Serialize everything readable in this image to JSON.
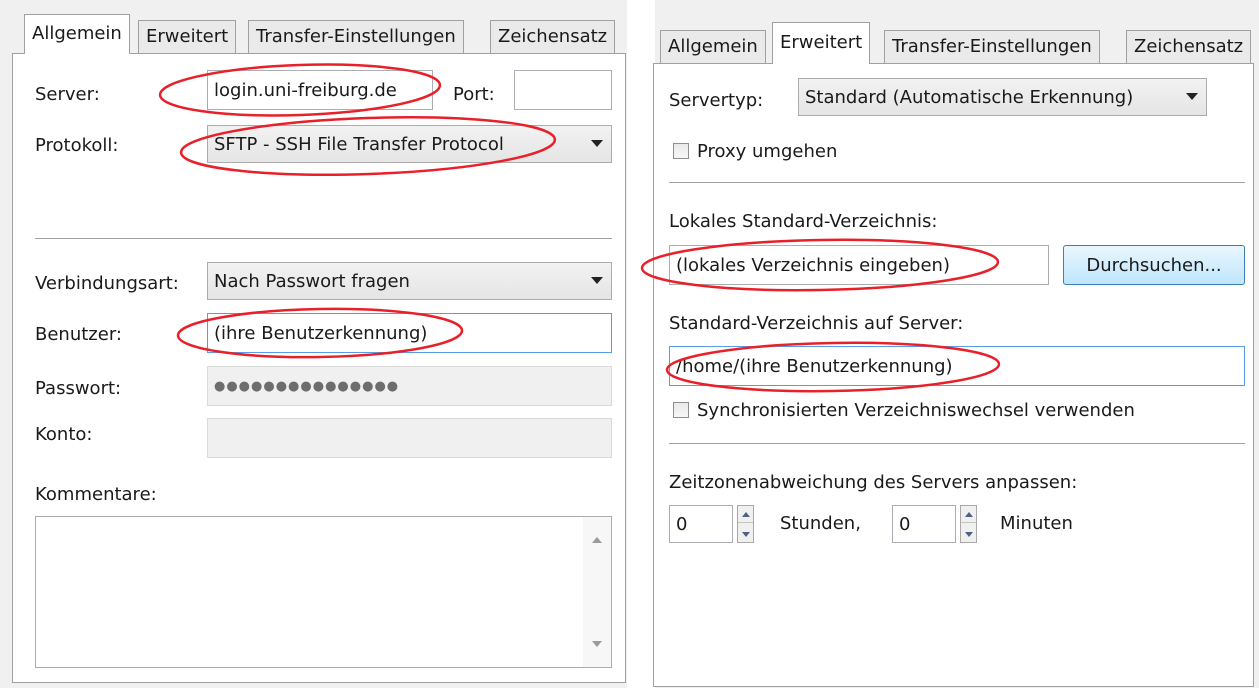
{
  "left": {
    "tabs": [
      "Allgemein",
      "Erweitert",
      "Transfer-Einstellungen",
      "Zeichensatz"
    ],
    "server_label": "Server:",
    "server_value": "login.uni-freiburg.de",
    "port_label": "Port:",
    "port_value": "",
    "protokoll_label": "Protokoll:",
    "protokoll_value": "SFTP - SSH File Transfer Protocol",
    "verbindungsart_label": "Verbindungsart:",
    "verbindungsart_value": "Nach Passwort fragen",
    "benutzer_label": "Benutzer:",
    "benutzer_value": "(ihre Benutzerkennung)",
    "passwort_label": "Passwort:",
    "passwort_value": "●●●●●●●●●●●●●●●",
    "konto_label": "Konto:",
    "kommentare_label": "Kommentare:"
  },
  "right": {
    "tabs": [
      "Allgemein",
      "Erweitert",
      "Transfer-Einstellungen",
      "Zeichensatz"
    ],
    "servertyp_label": "Servertyp:",
    "servertyp_value": "Standard (Automatische Erkennung)",
    "proxy_label": "Proxy umgehen",
    "lokales_label": "Lokales Standard-Verzeichnis:",
    "lokales_value": "(lokales Verzeichnis eingeben)",
    "durchsuchen_label": "Durchsuchen...",
    "server_dir_label": "Standard-Verzeichnis auf Server:",
    "server_dir_value": "/home/(ihre Benutzerkennung)",
    "sync_label": "Synchronisierten Verzeichniswechsel verwenden",
    "zeitzone_label": "Zeitzonenabweichung des Servers anpassen:",
    "hours_value": "0",
    "hours_label": "Stunden,",
    "minutes_value": "0",
    "minutes_label": "Minuten"
  },
  "colors": {
    "annotation": "#e8202a",
    "focus_border": "#569de5"
  }
}
